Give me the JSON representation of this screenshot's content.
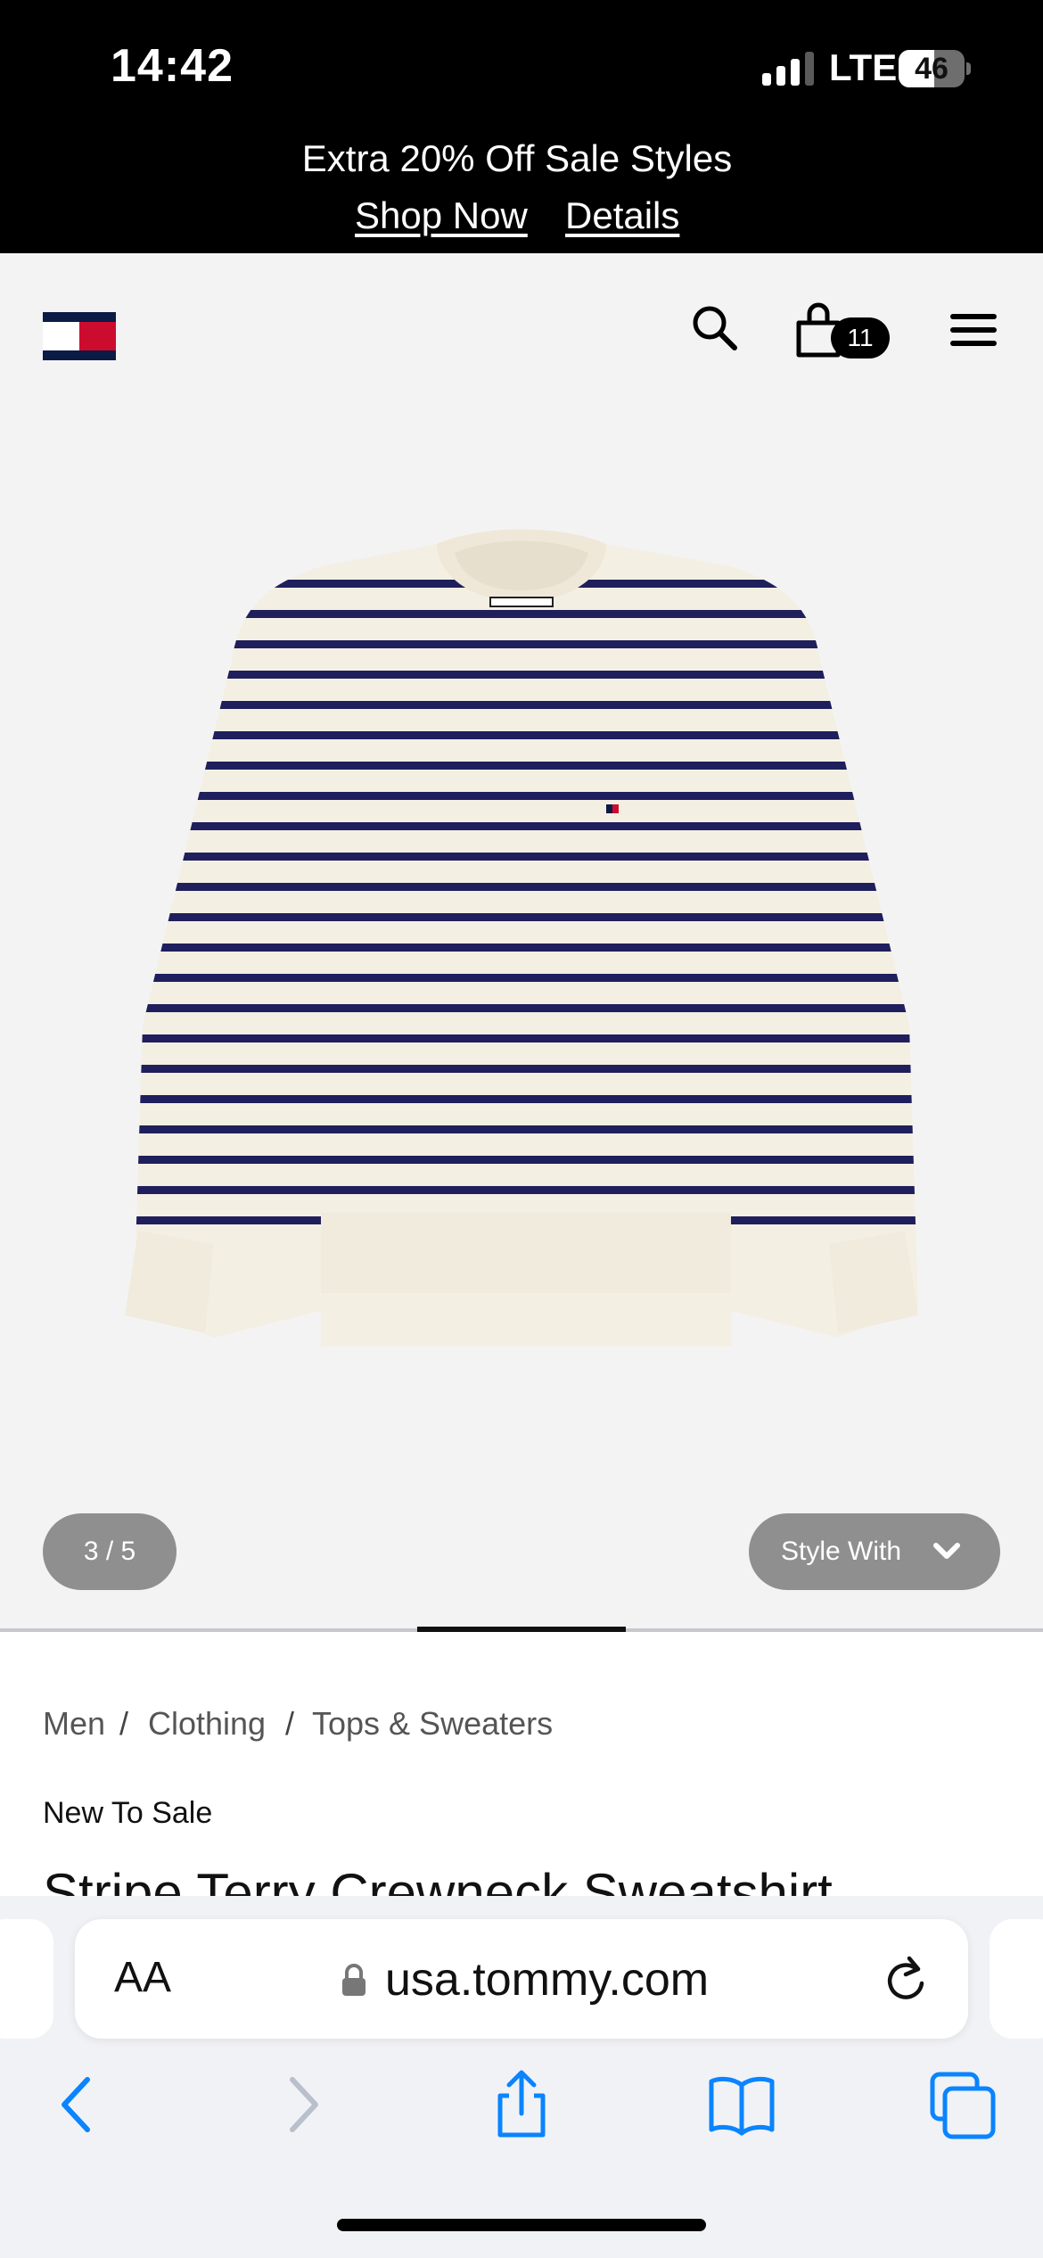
{
  "status_bar": {
    "time": "14:42",
    "network": "LTE",
    "battery": "46"
  },
  "promo": {
    "text": "Extra 20% Off Sale Styles",
    "shop_now": "Shop Now",
    "details": "Details"
  },
  "header": {
    "bag_count": "11",
    "icons": [
      "tommy-flag-logo",
      "search-icon",
      "shopping-bag-icon",
      "hamburger-menu-icon"
    ]
  },
  "gallery": {
    "counter": "3 / 5",
    "style_with": "Style With"
  },
  "breadcrumb": {
    "items": [
      "Men",
      "Clothing",
      "Tops & Sweaters"
    ],
    "separator": "/"
  },
  "product": {
    "badge": "New To Sale",
    "title": "Stripe Terry Crewneck Sweatshirt"
  },
  "browser": {
    "aa_label": "AA",
    "url": "usa.tommy.com"
  },
  "colors": {
    "accent_blue": "#0a84ff",
    "navy_stripe": "#1e1f5c",
    "cream": "#f4efe3",
    "flag_red": "#cc0c2f",
    "flag_navy": "#0c1a46"
  }
}
